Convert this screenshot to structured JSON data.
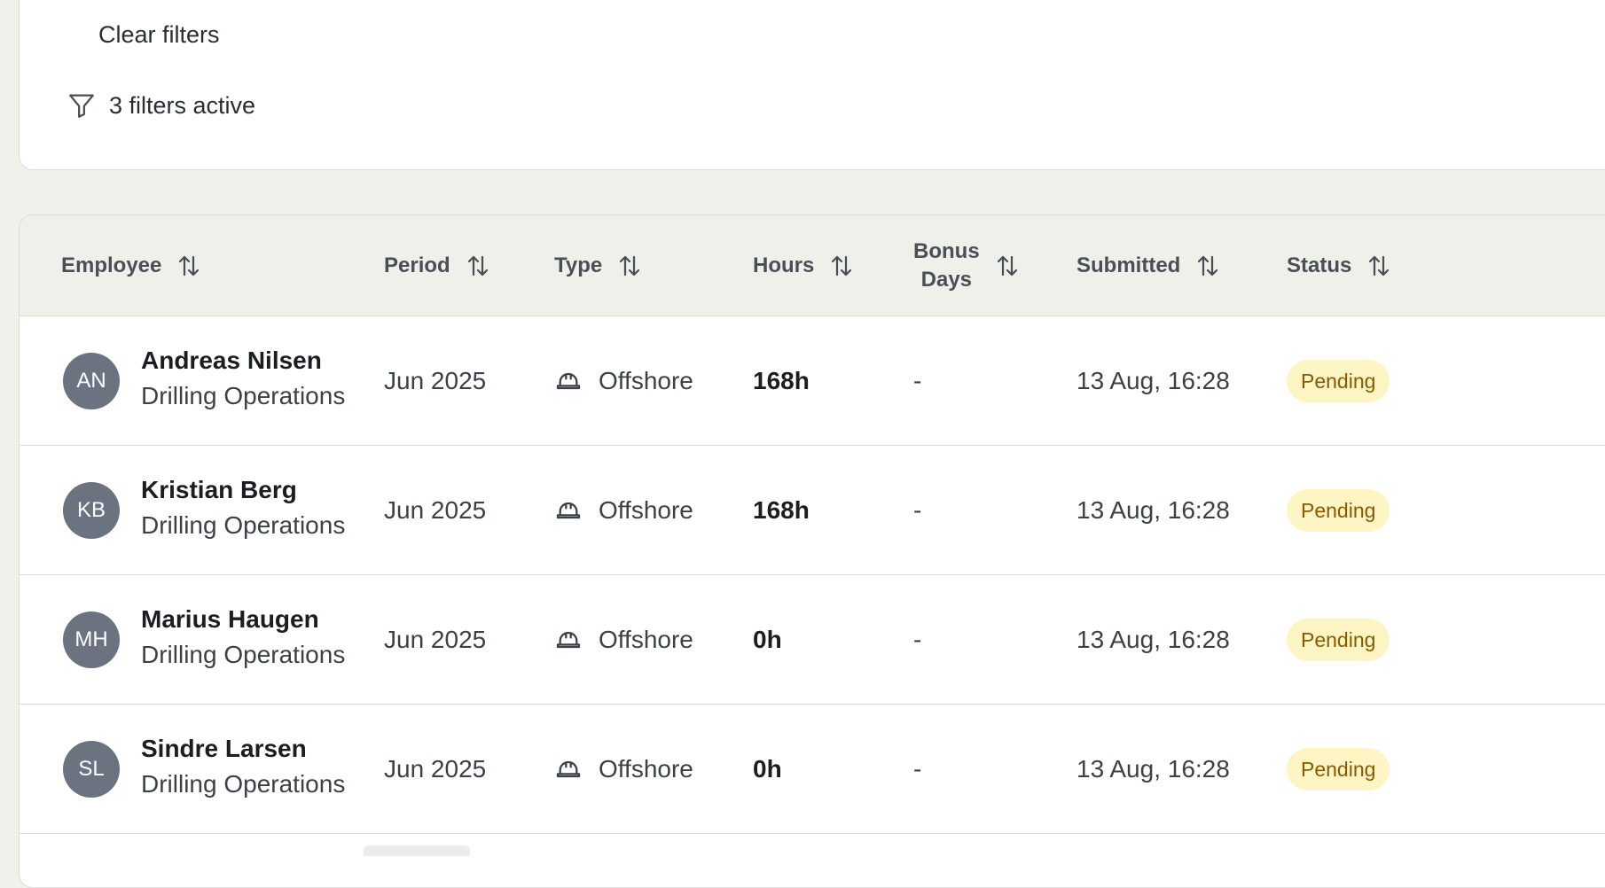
{
  "filters": {
    "clear_label": "Clear filters",
    "active_text": "3 filters active"
  },
  "table": {
    "columns": [
      "Employee",
      "Period",
      "Type",
      "Hours",
      "Bonus",
      "Days",
      "Submitted",
      "Status"
    ],
    "header": {
      "employee": "Employee",
      "period": "Period",
      "type": "Type",
      "hours": "Hours",
      "bonus_line1": "Bonus",
      "bonus_line2": "Days",
      "submitted": "Submitted",
      "status": "Status"
    },
    "rows": [
      {
        "initials": "AN",
        "name": "Andreas Nilsen",
        "department": "Drilling Operations",
        "period": "Jun 2025",
        "type": "Offshore",
        "hours": "168h",
        "bonus_days": "-",
        "submitted": "13 Aug, 16:28",
        "status": "Pending"
      },
      {
        "initials": "KB",
        "name": "Kristian Berg",
        "department": "Drilling Operations",
        "period": "Jun 2025",
        "type": "Offshore",
        "hours": "168h",
        "bonus_days": "-",
        "submitted": "13 Aug, 16:28",
        "status": "Pending"
      },
      {
        "initials": "MH",
        "name": "Marius Haugen",
        "department": "Drilling Operations",
        "period": "Jun 2025",
        "type": "Offshore",
        "hours": "0h",
        "bonus_days": "-",
        "submitted": "13 Aug, 16:28",
        "status": "Pending"
      },
      {
        "initials": "SL",
        "name": "Sindre Larsen",
        "department": "Drilling Operations",
        "period": "Jun 2025",
        "type": "Offshore",
        "hours": "0h",
        "bonus_days": "-",
        "submitted": "13 Aug, 16:28",
        "status": "Pending"
      }
    ]
  },
  "icons": {
    "filter": "filter-icon",
    "sort": "sort-arrows-icon",
    "offshore": "hard-hat-icon"
  },
  "colors": {
    "page_bg": "#f1f1ec",
    "header_bg": "#f0f0eb",
    "avatar_bg": "#6b7280",
    "pending_bg": "#fdf5c3",
    "pending_text": "#8a5a00"
  }
}
